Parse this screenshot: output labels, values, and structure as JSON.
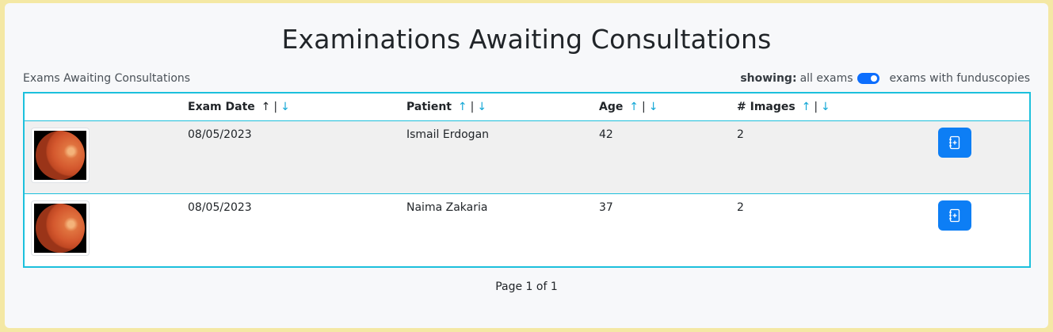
{
  "page": {
    "title": "Examinations Awaiting Consultations",
    "subtitle": "Exams Awaiting Consultations"
  },
  "filter": {
    "label": "showing:",
    "option_left": "all exams",
    "option_right": "exams with funduscopies",
    "state": "on"
  },
  "table": {
    "columns": {
      "date": "Exam Date",
      "patient": "Patient",
      "age": "Age",
      "images": "# Images"
    },
    "sort": {
      "up": "↑",
      "sep": "|",
      "down": "↓"
    },
    "rows": [
      {
        "date": "08/05/2023",
        "patient": "Ismail Erdogan",
        "age": "42",
        "images": "2"
      },
      {
        "date": "08/05/2023",
        "patient": "Naima Zakaria",
        "age": "37",
        "images": "2"
      }
    ],
    "action_icon": "add-note-icon"
  },
  "pagination": {
    "text": "Page 1 of 1"
  },
  "colors": {
    "accent": "#0d7ef5",
    "table_border": "#1cc0dc",
    "sort_active": "#12a7d6",
    "frame": "#f4e8a4"
  }
}
